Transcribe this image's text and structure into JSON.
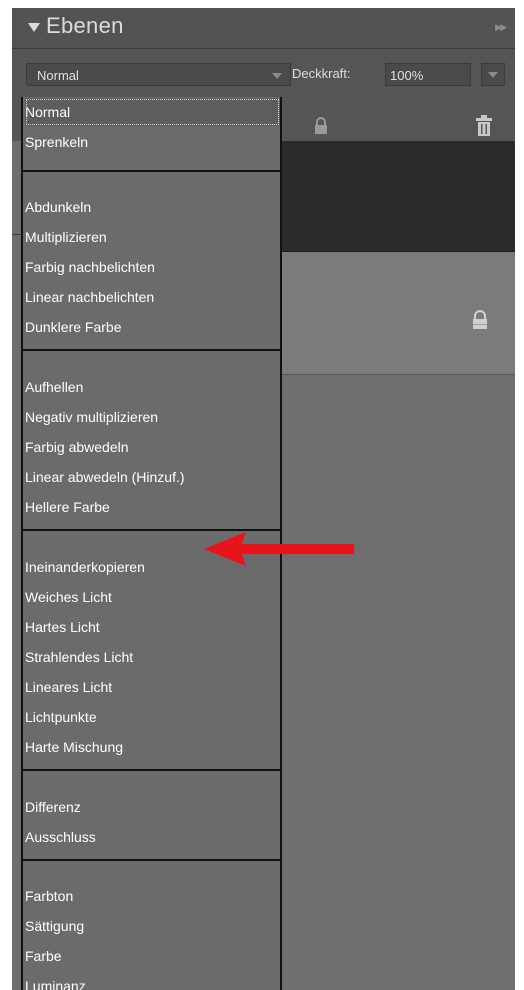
{
  "panel": {
    "title": "Ebenen"
  },
  "toolbar": {
    "blend_mode_value": "Normal",
    "opacity_label": "Deckkraft:",
    "opacity_value": "100%"
  },
  "blend_modes": {
    "groups": [
      {
        "items": [
          "Normal",
          "Sprenkeln"
        ]
      },
      {
        "items": [
          "Abdunkeln",
          "Multiplizieren",
          "Farbig nachbelichten",
          "Linear nachbelichten",
          "Dunklere Farbe"
        ]
      },
      {
        "items": [
          "Aufhellen",
          "Negativ multiplizieren",
          "Farbig abwedeln",
          "Linear abwedeln (Hinzuf.)",
          "Hellere Farbe"
        ]
      },
      {
        "items": [
          "Ineinanderkopieren",
          "Weiches Licht",
          "Hartes Licht",
          "Strahlendes Licht",
          "Lineares Licht",
          "Lichtpunkte",
          "Harte Mischung"
        ]
      },
      {
        "items": [
          "Differenz",
          "Ausschluss"
        ]
      },
      {
        "items": [
          "Farbton",
          "Sättigung",
          "Farbe",
          "Luminanz"
        ]
      }
    ],
    "selected": "Normal",
    "highlighted_by_arrow": "Ineinanderkopieren"
  },
  "icons": {
    "collapse": "triangle-down-icon",
    "expand": "double-chevron-right-icon",
    "select_arrow": "chevron-down-icon",
    "lock": "lock-icon",
    "trash": "trash-icon",
    "annotation": "red-arrow-icon"
  },
  "colors": {
    "panel_background": "#6e6e6e",
    "header_background": "#535353",
    "text": "#ffffff",
    "annotation_arrow": "#e8141b"
  }
}
